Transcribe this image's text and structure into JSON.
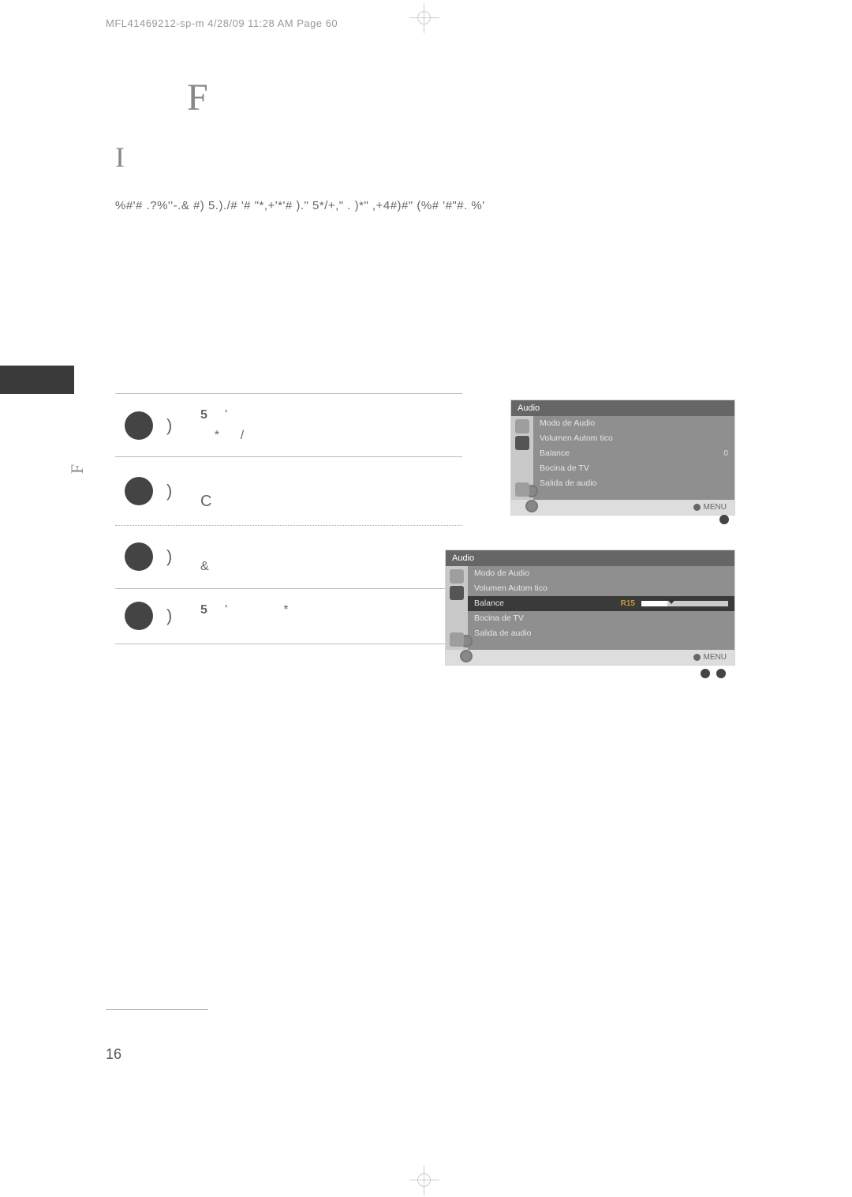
{
  "header": "MFL41469212-sp-m   4/28/09 11:28 AM  Page 60",
  "title_large": "F",
  "subtitle_large": "I",
  "body_text": "%#'# .?%''-.& #) 5.)./# '# \"*,+'*'# ).\" 5*/+,\" . )*\" ,+4#)#\"      (%# '#\"#. %'",
  "side_letter": "F",
  "steps": [
    {
      "paren": ")",
      "line1_a": "5",
      "line1_b": "'",
      "line2_a": "*",
      "line2_b": "/"
    },
    {
      "paren": ")",
      "big": "C"
    },
    {
      "paren": ")",
      "amp": "&"
    },
    {
      "paren": ")",
      "line_a": "5",
      "line_b": "'",
      "line_c": "*"
    }
  ],
  "osd1": {
    "title": "Audio",
    "rows": [
      {
        "label": "Modo de Audio"
      },
      {
        "label": "Volumen Autom tico"
      },
      {
        "label": "Balance",
        "value": "0"
      },
      {
        "label": "Bocina de TV"
      },
      {
        "label": "Salida de audio"
      }
    ],
    "footer": "MENU"
  },
  "osd2": {
    "title": "Audio",
    "rows": [
      {
        "label": "Modo de Audio"
      },
      {
        "label": "Volumen Autom tico"
      },
      {
        "label": "Balance",
        "valueR": "R15",
        "slider": true,
        "selected": true
      },
      {
        "label": "Bocina de TV"
      },
      {
        "label": "Salida de audio"
      }
    ],
    "footer": "MENU"
  },
  "page_number": "16"
}
